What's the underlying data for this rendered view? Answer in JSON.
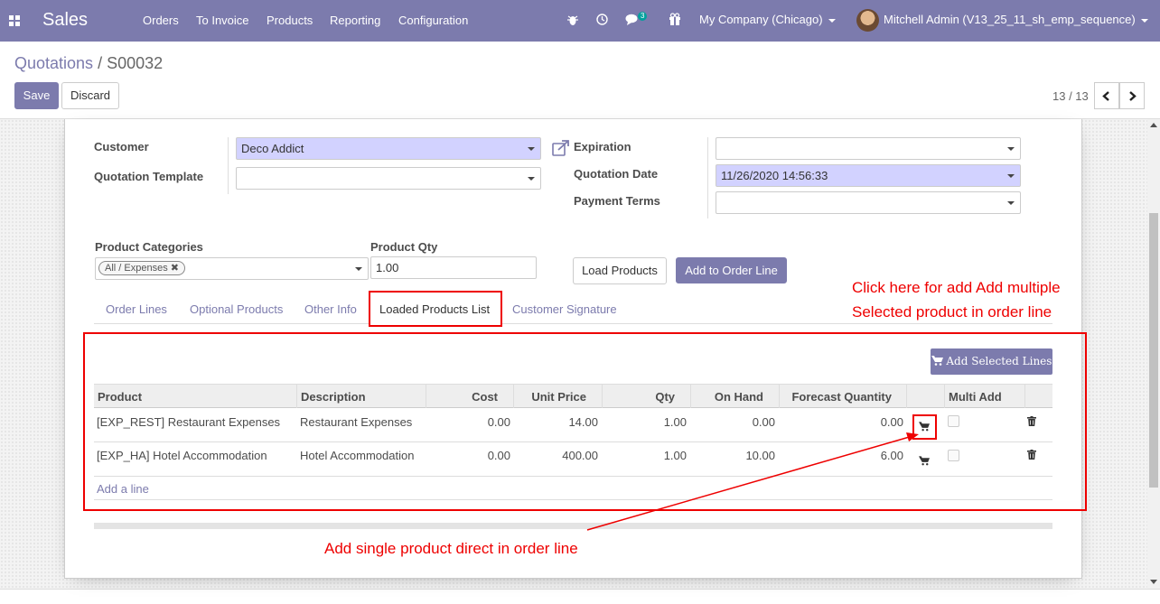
{
  "navbar": {
    "app_name": "Sales",
    "menus": [
      "Orders",
      "To Invoice",
      "Products",
      "Reporting",
      "Configuration"
    ],
    "message_count": "3",
    "company": "My Company (Chicago)",
    "user": "Mitchell Admin (V13_25_11_sh_emp_sequence)"
  },
  "breadcrumb": {
    "parent": "Quotations",
    "separator": "/",
    "current": "S00032"
  },
  "buttons": {
    "save": "Save",
    "discard": "Discard"
  },
  "pager": {
    "value": "13 / 13"
  },
  "form": {
    "customer_label": "Customer",
    "customer_value": "Deco Addict",
    "template_label": "Quotation Template",
    "template_value": "",
    "expiration_label": "Expiration",
    "expiration_value": "",
    "quotation_date_label": "Quotation Date",
    "quotation_date_value": "11/26/2020 14:56:33",
    "payment_terms_label": "Payment Terms",
    "payment_terms_value": "",
    "product_categories_label": "Product Categories",
    "product_category_tag": "All / Expenses",
    "product_qty_label": "Product Qty",
    "product_qty_value": "1.00",
    "load_products": "Load Products",
    "add_to_order_line": "Add to Order Line"
  },
  "tabs": [
    "Order Lines",
    "Optional Products",
    "Other Info",
    "Loaded Products List",
    "Customer Signature"
  ],
  "annotations": {
    "multi_line1": "Click here for add Add multiple",
    "multi_line2": "Selected product in order line",
    "single": "Add single product direct in order line"
  },
  "table": {
    "add_selected": "Add Selected Lines",
    "columns": [
      "Product",
      "Description",
      "Cost",
      "Unit Price",
      "Qty",
      "On Hand",
      "Forecast Quantity",
      "Multi Add"
    ],
    "rows": [
      {
        "product": "[EXP_REST] Restaurant Expenses",
        "description": "Restaurant Expenses",
        "cost": "0.00",
        "unit_price": "14.00",
        "qty": "1.00",
        "on_hand": "0.00",
        "forecast": "0.00"
      },
      {
        "product": "[EXP_HA] Hotel Accommodation",
        "description": "Hotel Accommodation",
        "cost": "0.00",
        "unit_price": "400.00",
        "qty": "1.00",
        "on_hand": "10.00",
        "forecast": "6.00"
      }
    ],
    "add_line": "Add a line"
  },
  "colors": {
    "brand": "#7c7bad",
    "annotation": "#ee0000",
    "required_field": "#d2d2ff"
  },
  "icons": [
    "apps-icon",
    "bug-icon",
    "clock-icon",
    "chat-icon",
    "gift-icon",
    "external-link-icon",
    "cart-icon",
    "trash-icon",
    "chevron-left-icon",
    "chevron-right-icon"
  ]
}
